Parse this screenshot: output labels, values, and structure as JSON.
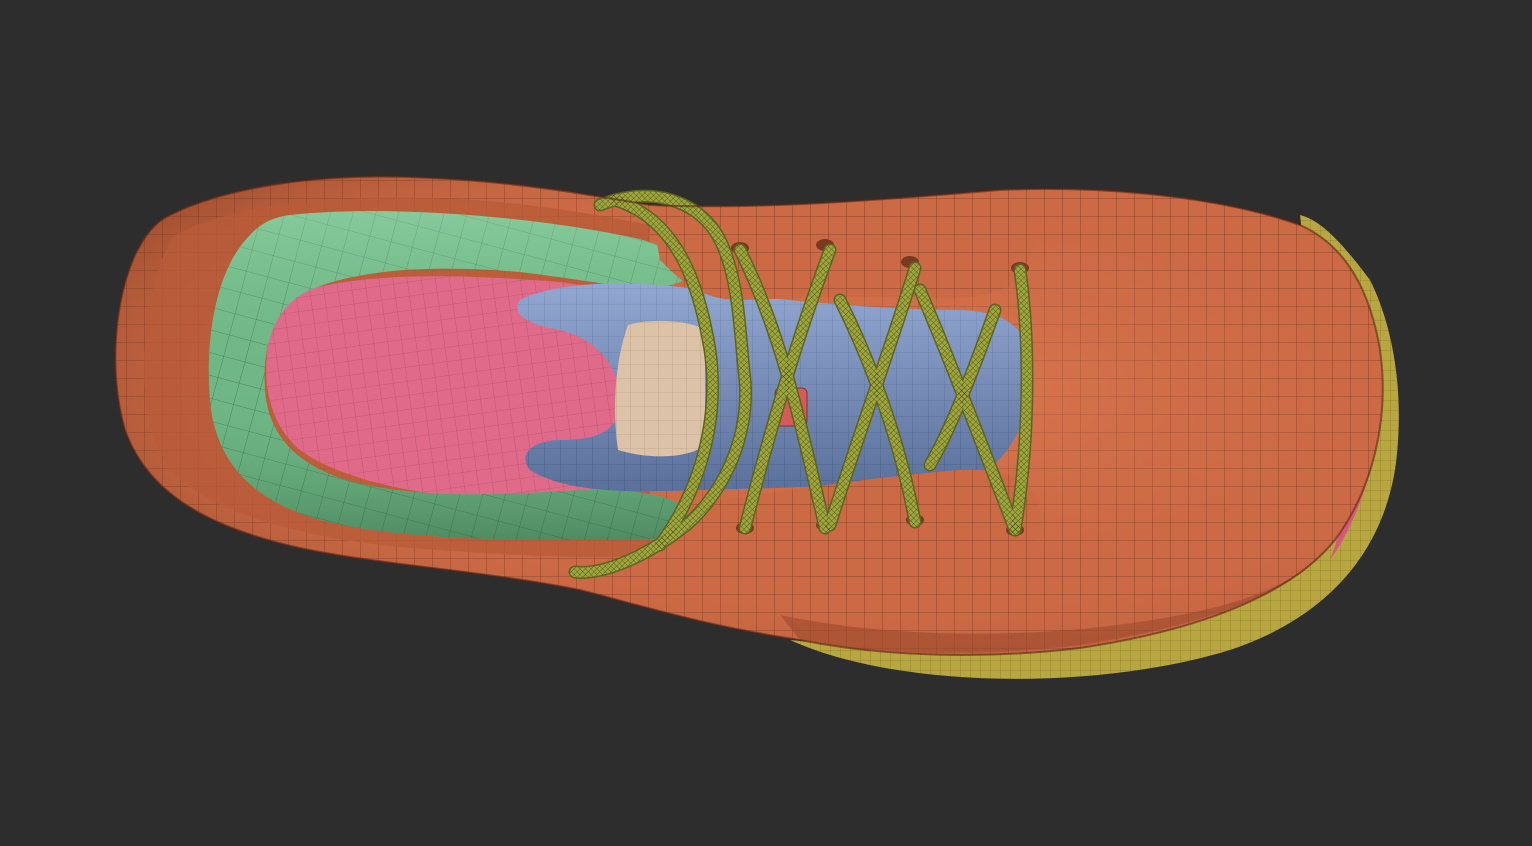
{
  "viewport": {
    "background": "#2d2d2d"
  },
  "model": {
    "subject": "shoe-mesh-top-view",
    "polygroup_colors": {
      "upper": "#cc6a45",
      "upper_dark": "#9c4a2d",
      "collar": "#6fb886",
      "collar_dark": "#4b8a5f",
      "insole": "#e06a8a",
      "tongue": "#7b93c0",
      "tongue_dark": "#566f9c",
      "tongue_patch": "#dcc2a6",
      "lace": "#9ea63c",
      "lace_dark": "#5d6322",
      "sole": "#b8a740",
      "toe_accent": "#d9577e",
      "tab": "#d65a5a",
      "wire": "#1a1a1a"
    }
  }
}
